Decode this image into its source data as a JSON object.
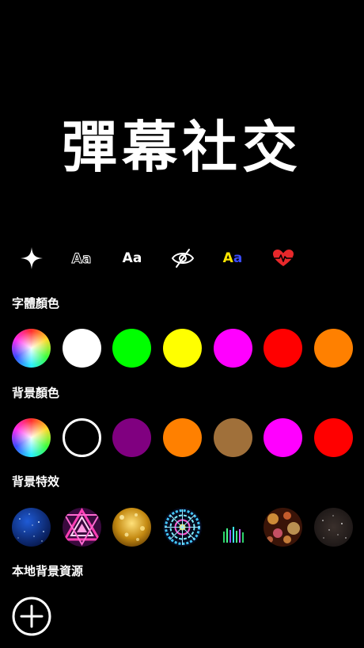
{
  "app": {
    "title": "彈幕社交"
  },
  "toolbar": {
    "items": [
      {
        "name": "sparkle",
        "icon": "sparkle-icon"
      },
      {
        "name": "outline-text",
        "icon": "outline-text-icon",
        "label": "Aa"
      },
      {
        "name": "plain-text",
        "icon": "plain-text-icon",
        "label": "Aa"
      },
      {
        "name": "hide",
        "icon": "eye-slash-icon"
      },
      {
        "name": "color-text",
        "icon": "color-text-icon",
        "label_a": "A",
        "label_b": "a"
      },
      {
        "name": "heartbeat",
        "icon": "heartbeat-icon"
      }
    ]
  },
  "font_colors": {
    "label": "字體顏色",
    "swatches": [
      "rainbow",
      "#ffffff",
      "#00ff00",
      "#ffff00",
      "#ff00ff",
      "#ff0000",
      "#ff8000"
    ]
  },
  "background_colors": {
    "label": "背景顏色",
    "swatches": [
      "rainbow",
      "none",
      "#800080",
      "#ff8000",
      "#a0703a",
      "#ff00ff",
      "#ff0000"
    ]
  },
  "background_effects": {
    "label": "背景特效",
    "items": [
      "starfield-blue",
      "neon-triangles",
      "gold-glitter",
      "blue-kaleidoscope",
      "aurora-bars",
      "bokeh-lights",
      "dark-stars"
    ]
  },
  "local_backgrounds": {
    "label": "本地背景資源",
    "add_icon": "plus-circle-icon"
  }
}
